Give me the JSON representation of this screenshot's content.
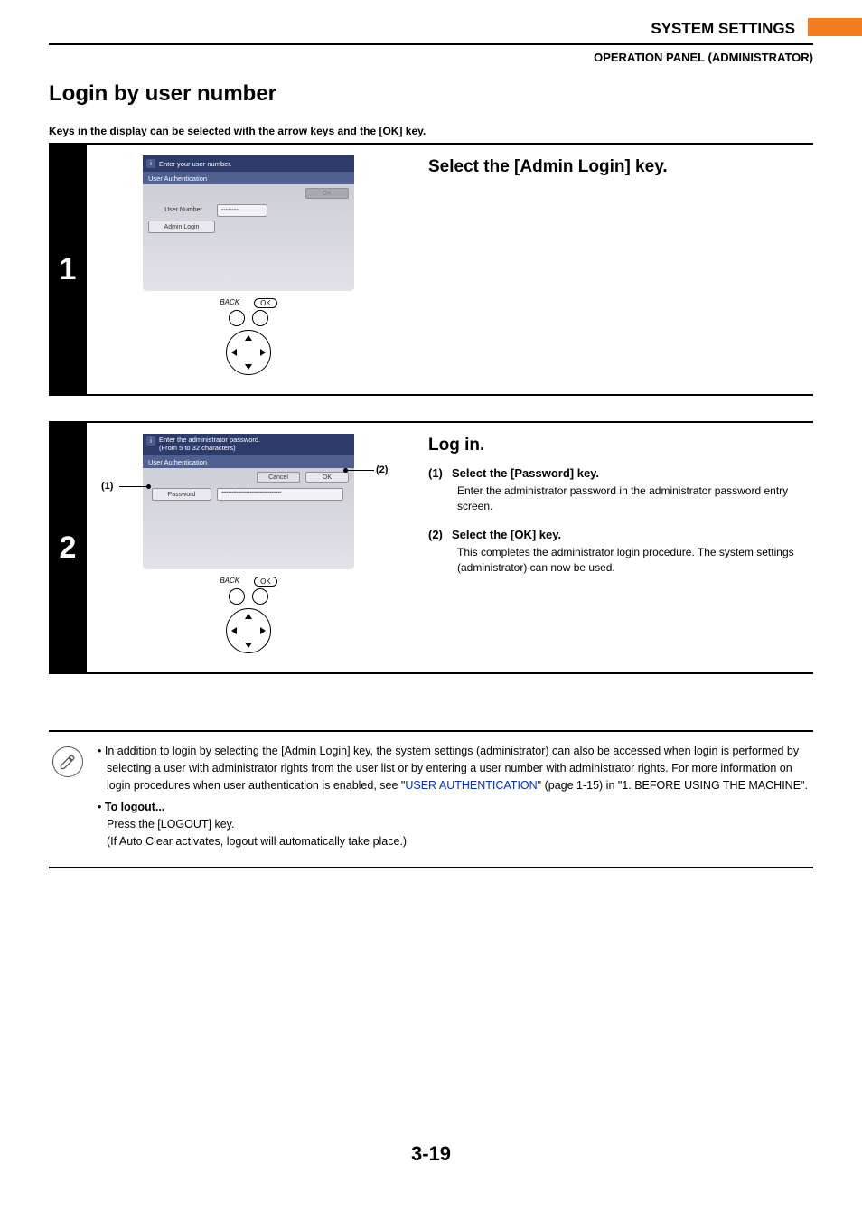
{
  "header": {
    "section": "SYSTEM SETTINGS",
    "subsection": "OPERATION PANEL (ADMINISTRATOR)"
  },
  "page": {
    "title": "Login by user number",
    "intro": "Keys in the display can be selected with the arrow keys and the [OK] key.",
    "number": "3-19"
  },
  "step1": {
    "num": "1",
    "title": "Select the [Admin Login] key.",
    "screen": {
      "title": "Enter your user number.",
      "subtitle": "User Authentication",
      "ok": "OK",
      "user_number_label": "User Number",
      "user_number_value": "--------",
      "admin_login": "Admin Login"
    },
    "panel": {
      "back": "BACK",
      "ok": "OK"
    }
  },
  "step2": {
    "num": "2",
    "title": "Log in.",
    "screen": {
      "title1": "Enter the administrator password.",
      "title2": "(From 5 to 32 characters)",
      "subtitle": "User Authentication",
      "cancel": "Cancel",
      "ok": "OK",
      "password_label": "Password",
      "password_value": "************************************"
    },
    "panel": {
      "back": "BACK",
      "ok": "OK"
    },
    "callouts": {
      "c1": "(1)",
      "c2": "(2)"
    },
    "items": [
      {
        "num": "(1)",
        "label": "Select the [Password] key.",
        "desc": "Enter the administrator password in the administrator password entry screen."
      },
      {
        "num": "(2)",
        "label": "Select the [OK] key.",
        "desc": "This completes the administrator login procedure. The system settings (administrator) can now be used."
      }
    ]
  },
  "notes": {
    "bullet1a": "In addition to login by selecting the [Admin Login] key, the system settings (administrator) can also be accessed when login is performed by selecting a user with administrator rights from the user list or by entering a user number with administrator rights. For more information on login procedures when user authentication is enabled, see \"",
    "bullet1_link": "USER AUTHENTICATION",
    "bullet1b": "\" (page 1-15) in \"1. BEFORE USING THE MACHINE\".",
    "bullet2_title": "To logout...",
    "bullet2_line1": "Press the [LOGOUT] key.",
    "bullet2_line2": "(If Auto Clear activates, logout will automatically take place.)"
  }
}
